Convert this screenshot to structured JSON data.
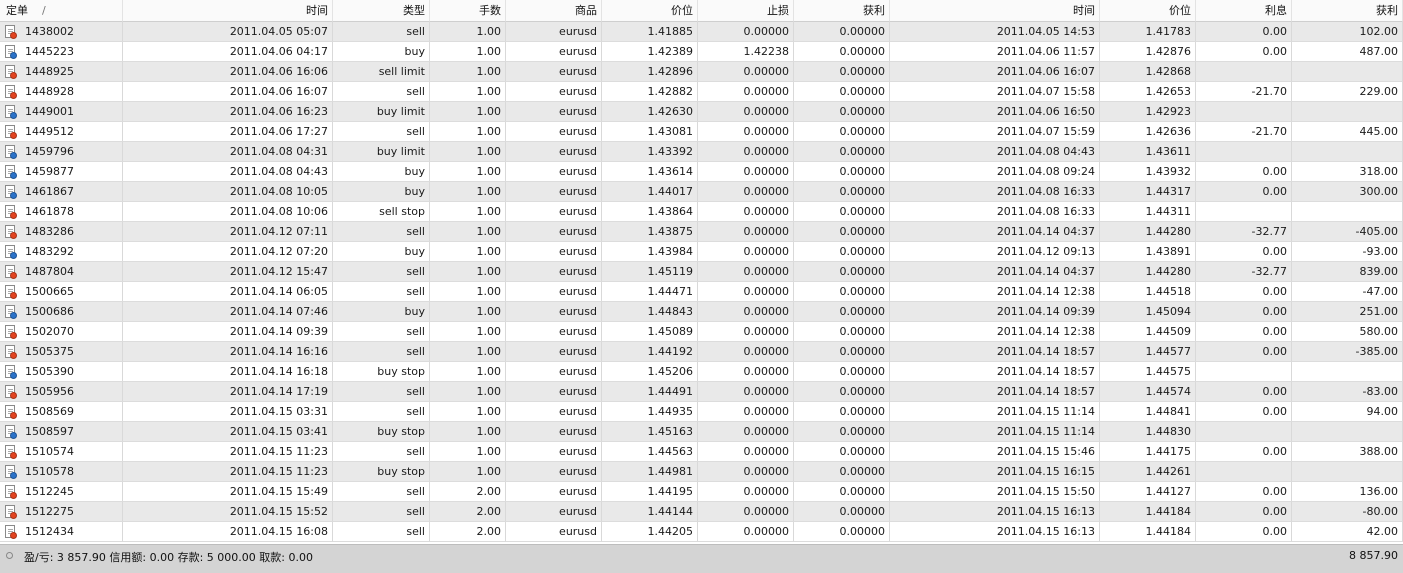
{
  "colors": {
    "sell_dot": "#e2431f",
    "buy_dot": "#2a72c9",
    "row_alt": "#e9e9e9",
    "status_bg": "#d4d4d4"
  },
  "columns": [
    "定单",
    "时间",
    "类型",
    "手数",
    "商品",
    "价位",
    "止损",
    "获利",
    "时间",
    "价位",
    "利息",
    "获利"
  ],
  "sort_indicator": "/",
  "rows": [
    {
      "ticket": "1438002",
      "open_time": "2011.04.05 05:07",
      "type": "sell",
      "lots": "1.00",
      "symbol": "eurusd",
      "open_price": "1.41885",
      "sl": "0.00000",
      "tp": "0.00000",
      "close_time": "2011.04.05 14:53",
      "close_price": "1.41783",
      "swap": "0.00",
      "profit": "102.00",
      "icon": "sell"
    },
    {
      "ticket": "1445223",
      "open_time": "2011.04.06 04:17",
      "type": "buy",
      "lots": "1.00",
      "symbol": "eurusd",
      "open_price": "1.42389",
      "sl": "1.42238",
      "tp": "0.00000",
      "close_time": "2011.04.06 11:57",
      "close_price": "1.42876",
      "swap": "0.00",
      "profit": "487.00",
      "icon": "buy"
    },
    {
      "ticket": "1448925",
      "open_time": "2011.04.06 16:06",
      "type": "sell limit",
      "lots": "1.00",
      "symbol": "eurusd",
      "open_price": "1.42896",
      "sl": "0.00000",
      "tp": "0.00000",
      "close_time": "2011.04.06 16:07",
      "close_price": "1.42868",
      "swap": "",
      "profit": "",
      "icon": "sell"
    },
    {
      "ticket": "1448928",
      "open_time": "2011.04.06 16:07",
      "type": "sell",
      "lots": "1.00",
      "symbol": "eurusd",
      "open_price": "1.42882",
      "sl": "0.00000",
      "tp": "0.00000",
      "close_time": "2011.04.07 15:58",
      "close_price": "1.42653",
      "swap": "-21.70",
      "profit": "229.00",
      "icon": "sell"
    },
    {
      "ticket": "1449001",
      "open_time": "2011.04.06 16:23",
      "type": "buy limit",
      "lots": "1.00",
      "symbol": "eurusd",
      "open_price": "1.42630",
      "sl": "0.00000",
      "tp": "0.00000",
      "close_time": "2011.04.06 16:50",
      "close_price": "1.42923",
      "swap": "",
      "profit": "",
      "icon": "buy"
    },
    {
      "ticket": "1449512",
      "open_time": "2011.04.06 17:27",
      "type": "sell",
      "lots": "1.00",
      "symbol": "eurusd",
      "open_price": "1.43081",
      "sl": "0.00000",
      "tp": "0.00000",
      "close_time": "2011.04.07 15:59",
      "close_price": "1.42636",
      "swap": "-21.70",
      "profit": "445.00",
      "icon": "sell"
    },
    {
      "ticket": "1459796",
      "open_time": "2011.04.08 04:31",
      "type": "buy limit",
      "lots": "1.00",
      "symbol": "eurusd",
      "open_price": "1.43392",
      "sl": "0.00000",
      "tp": "0.00000",
      "close_time": "2011.04.08 04:43",
      "close_price": "1.43611",
      "swap": "",
      "profit": "",
      "icon": "buy"
    },
    {
      "ticket": "1459877",
      "open_time": "2011.04.08 04:43",
      "type": "buy",
      "lots": "1.00",
      "symbol": "eurusd",
      "open_price": "1.43614",
      "sl": "0.00000",
      "tp": "0.00000",
      "close_time": "2011.04.08 09:24",
      "close_price": "1.43932",
      "swap": "0.00",
      "profit": "318.00",
      "icon": "buy"
    },
    {
      "ticket": "1461867",
      "open_time": "2011.04.08 10:05",
      "type": "buy",
      "lots": "1.00",
      "symbol": "eurusd",
      "open_price": "1.44017",
      "sl": "0.00000",
      "tp": "0.00000",
      "close_time": "2011.04.08 16:33",
      "close_price": "1.44317",
      "swap": "0.00",
      "profit": "300.00",
      "icon": "buy"
    },
    {
      "ticket": "1461878",
      "open_time": "2011.04.08 10:06",
      "type": "sell stop",
      "lots": "1.00",
      "symbol": "eurusd",
      "open_price": "1.43864",
      "sl": "0.00000",
      "tp": "0.00000",
      "close_time": "2011.04.08 16:33",
      "close_price": "1.44311",
      "swap": "",
      "profit": "",
      "icon": "sell"
    },
    {
      "ticket": "1483286",
      "open_time": "2011.04.12 07:11",
      "type": "sell",
      "lots": "1.00",
      "symbol": "eurusd",
      "open_price": "1.43875",
      "sl": "0.00000",
      "tp": "0.00000",
      "close_time": "2011.04.14 04:37",
      "close_price": "1.44280",
      "swap": "-32.77",
      "profit": "-405.00",
      "icon": "sell"
    },
    {
      "ticket": "1483292",
      "open_time": "2011.04.12 07:20",
      "type": "buy",
      "lots": "1.00",
      "symbol": "eurusd",
      "open_price": "1.43984",
      "sl": "0.00000",
      "tp": "0.00000",
      "close_time": "2011.04.12 09:13",
      "close_price": "1.43891",
      "swap": "0.00",
      "profit": "-93.00",
      "icon": "buy"
    },
    {
      "ticket": "1487804",
      "open_time": "2011.04.12 15:47",
      "type": "sell",
      "lots": "1.00",
      "symbol": "eurusd",
      "open_price": "1.45119",
      "sl": "0.00000",
      "tp": "0.00000",
      "close_time": "2011.04.14 04:37",
      "close_price": "1.44280",
      "swap": "-32.77",
      "profit": "839.00",
      "icon": "sell"
    },
    {
      "ticket": "1500665",
      "open_time": "2011.04.14 06:05",
      "type": "sell",
      "lots": "1.00",
      "symbol": "eurusd",
      "open_price": "1.44471",
      "sl": "0.00000",
      "tp": "0.00000",
      "close_time": "2011.04.14 12:38",
      "close_price": "1.44518",
      "swap": "0.00",
      "profit": "-47.00",
      "icon": "sell"
    },
    {
      "ticket": "1500686",
      "open_time": "2011.04.14 07:46",
      "type": "buy",
      "lots": "1.00",
      "symbol": "eurusd",
      "open_price": "1.44843",
      "sl": "0.00000",
      "tp": "0.00000",
      "close_time": "2011.04.14 09:39",
      "close_price": "1.45094",
      "swap": "0.00",
      "profit": "251.00",
      "icon": "buy"
    },
    {
      "ticket": "1502070",
      "open_time": "2011.04.14 09:39",
      "type": "sell",
      "lots": "1.00",
      "symbol": "eurusd",
      "open_price": "1.45089",
      "sl": "0.00000",
      "tp": "0.00000",
      "close_time": "2011.04.14 12:38",
      "close_price": "1.44509",
      "swap": "0.00",
      "profit": "580.00",
      "icon": "sell"
    },
    {
      "ticket": "1505375",
      "open_time": "2011.04.14 16:16",
      "type": "sell",
      "lots": "1.00",
      "symbol": "eurusd",
      "open_price": "1.44192",
      "sl": "0.00000",
      "tp": "0.00000",
      "close_time": "2011.04.14 18:57",
      "close_price": "1.44577",
      "swap": "0.00",
      "profit": "-385.00",
      "icon": "sell"
    },
    {
      "ticket": "1505390",
      "open_time": "2011.04.14 16:18",
      "type": "buy stop",
      "lots": "1.00",
      "symbol": "eurusd",
      "open_price": "1.45206",
      "sl": "0.00000",
      "tp": "0.00000",
      "close_time": "2011.04.14 18:57",
      "close_price": "1.44575",
      "swap": "",
      "profit": "",
      "icon": "buy"
    },
    {
      "ticket": "1505956",
      "open_time": "2011.04.14 17:19",
      "type": "sell",
      "lots": "1.00",
      "symbol": "eurusd",
      "open_price": "1.44491",
      "sl": "0.00000",
      "tp": "0.00000",
      "close_time": "2011.04.14 18:57",
      "close_price": "1.44574",
      "swap": "0.00",
      "profit": "-83.00",
      "icon": "sell"
    },
    {
      "ticket": "1508569",
      "open_time": "2011.04.15 03:31",
      "type": "sell",
      "lots": "1.00",
      "symbol": "eurusd",
      "open_price": "1.44935",
      "sl": "0.00000",
      "tp": "0.00000",
      "close_time": "2011.04.15 11:14",
      "close_price": "1.44841",
      "swap": "0.00",
      "profit": "94.00",
      "icon": "sell"
    },
    {
      "ticket": "1508597",
      "open_time": "2011.04.15 03:41",
      "type": "buy stop",
      "lots": "1.00",
      "symbol": "eurusd",
      "open_price": "1.45163",
      "sl": "0.00000",
      "tp": "0.00000",
      "close_time": "2011.04.15 11:14",
      "close_price": "1.44830",
      "swap": "",
      "profit": "",
      "icon": "buy"
    },
    {
      "ticket": "1510574",
      "open_time": "2011.04.15 11:23",
      "type": "sell",
      "lots": "1.00",
      "symbol": "eurusd",
      "open_price": "1.44563",
      "sl": "0.00000",
      "tp": "0.00000",
      "close_time": "2011.04.15 15:46",
      "close_price": "1.44175",
      "swap": "0.00",
      "profit": "388.00",
      "icon": "sell"
    },
    {
      "ticket": "1510578",
      "open_time": "2011.04.15 11:23",
      "type": "buy stop",
      "lots": "1.00",
      "symbol": "eurusd",
      "open_price": "1.44981",
      "sl": "0.00000",
      "tp": "0.00000",
      "close_time": "2011.04.15 16:15",
      "close_price": "1.44261",
      "swap": "",
      "profit": "",
      "icon": "buy"
    },
    {
      "ticket": "1512245",
      "open_time": "2011.04.15 15:49",
      "type": "sell",
      "lots": "2.00",
      "symbol": "eurusd",
      "open_price": "1.44195",
      "sl": "0.00000",
      "tp": "0.00000",
      "close_time": "2011.04.15 15:50",
      "close_price": "1.44127",
      "swap": "0.00",
      "profit": "136.00",
      "icon": "sell"
    },
    {
      "ticket": "1512275",
      "open_time": "2011.04.15 15:52",
      "type": "sell",
      "lots": "2.00",
      "symbol": "eurusd",
      "open_price": "1.44144",
      "sl": "0.00000",
      "tp": "0.00000",
      "close_time": "2011.04.15 16:13",
      "close_price": "1.44184",
      "swap": "0.00",
      "profit": "-80.00",
      "icon": "sell"
    },
    {
      "ticket": "1512434",
      "open_time": "2011.04.15 16:08",
      "type": "sell",
      "lots": "2.00",
      "symbol": "eurusd",
      "open_price": "1.44205",
      "sl": "0.00000",
      "tp": "0.00000",
      "close_time": "2011.04.15 16:13",
      "close_price": "1.44184",
      "swap": "0.00",
      "profit": "42.00",
      "icon": "sell"
    }
  ],
  "status": {
    "summary": "盈/亏: 3 857.90  信用额: 0.00  存款: 5 000.00  取款: 0.00",
    "total": "8 857.90"
  }
}
